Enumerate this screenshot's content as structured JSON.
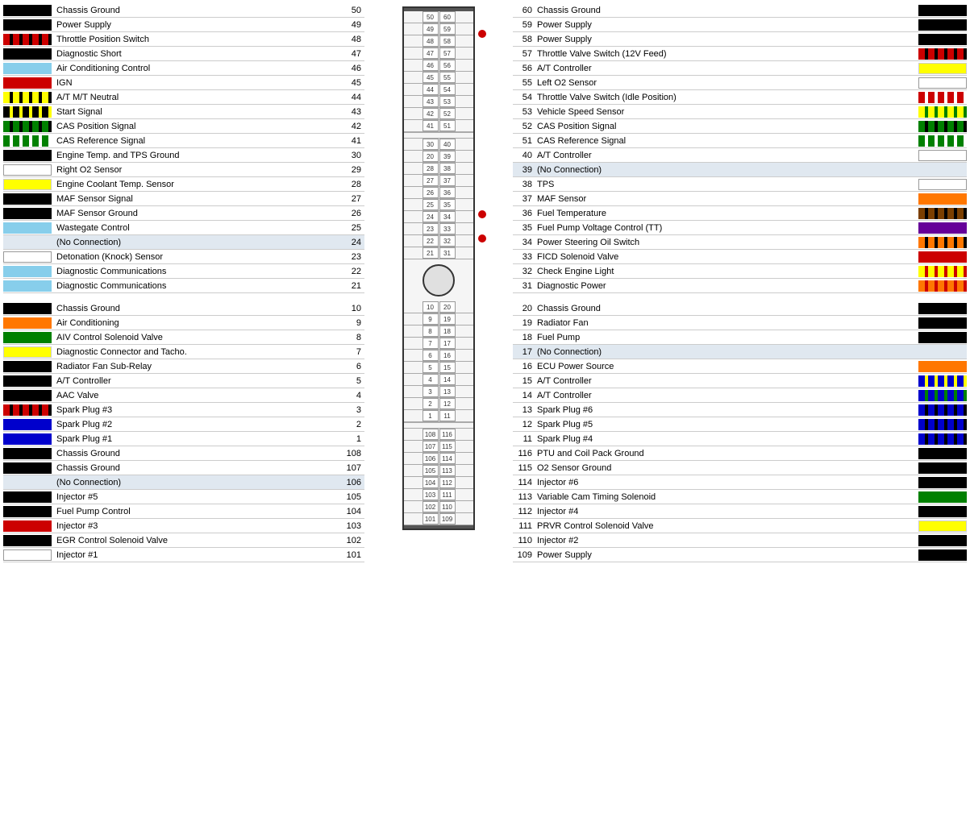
{
  "left_pins": [
    {
      "num": "50",
      "label": "Chassis Ground",
      "wire": "w-black"
    },
    {
      "num": "49",
      "label": "Power Supply",
      "wire": "w-black"
    },
    {
      "num": "48",
      "label": "Throttle Position Switch",
      "wire": "w-red-black"
    },
    {
      "num": "47",
      "label": "Diagnostic Short",
      "wire": "w-black"
    },
    {
      "num": "46",
      "label": "Air Conditioning Control",
      "wire": "w-lightblue"
    },
    {
      "num": "45",
      "label": "IGN",
      "wire": "w-red"
    },
    {
      "num": "44",
      "label": "A/T M/T Neutral",
      "wire": "w-yellow-black"
    },
    {
      "num": "43",
      "label": "Start Signal",
      "wire": "w-black-yellow"
    },
    {
      "num": "42",
      "label": "CAS Position Signal",
      "wire": "w-green-black"
    },
    {
      "num": "41",
      "label": "CAS Reference Signal",
      "wire": "w-green-white"
    },
    {
      "num": "30",
      "label": "Engine Temp. and TPS Ground",
      "wire": "w-black"
    },
    {
      "num": "29",
      "label": "Right O2 Sensor",
      "wire": "w-white"
    },
    {
      "num": "28",
      "label": "Engine Coolant Temp. Sensor",
      "wire": "w-yellow"
    },
    {
      "num": "27",
      "label": "MAF Sensor Signal",
      "wire": "w-black"
    },
    {
      "num": "26",
      "label": "MAF Sensor Ground",
      "wire": "w-black"
    },
    {
      "num": "25",
      "label": "Wastegate Control",
      "wire": "w-lightblue"
    },
    {
      "num": "24",
      "label": "(No Connection)",
      "wire": "w-none",
      "noconn": true
    },
    {
      "num": "23",
      "label": "Detonation (Knock) Sensor",
      "wire": "w-white"
    },
    {
      "num": "22",
      "label": "Diagnostic Communications",
      "wire": "w-lightblue"
    },
    {
      "num": "21",
      "label": "Diagnostic Communications",
      "wire": "w-lightblue"
    },
    {
      "num": "",
      "label": "",
      "wire": "w-none",
      "spacer": true
    },
    {
      "num": "10",
      "label": "Chassis Ground",
      "wire": "w-black"
    },
    {
      "num": "9",
      "label": "Air Conditioning",
      "wire": "w-orange"
    },
    {
      "num": "8",
      "label": "AIV Control Solenoid Valve",
      "wire": "w-green"
    },
    {
      "num": "7",
      "label": "Diagnostic Connector and Tacho.",
      "wire": "w-yellow"
    },
    {
      "num": "6",
      "label": "Radiator Fan Sub-Relay",
      "wire": "w-black"
    },
    {
      "num": "5",
      "label": "A/T Controller",
      "wire": "w-black"
    },
    {
      "num": "4",
      "label": "AAC Valve",
      "wire": "w-black"
    },
    {
      "num": "3",
      "label": "Spark Plug #3",
      "wire": "w-red-black"
    },
    {
      "num": "2",
      "label": "Spark Plug #2",
      "wire": "w-blue"
    },
    {
      "num": "1",
      "label": "Spark Plug #1",
      "wire": "w-blue"
    },
    {
      "num": "108",
      "label": "Chassis Ground",
      "wire": "w-black"
    },
    {
      "num": "107",
      "label": "Chassis Ground",
      "wire": "w-black"
    },
    {
      "num": "106",
      "label": "(No Connection)",
      "wire": "w-none",
      "noconn": true
    },
    {
      "num": "105",
      "label": "Injector #5",
      "wire": "w-black"
    },
    {
      "num": "104",
      "label": "Fuel Pump Control",
      "wire": "w-black"
    },
    {
      "num": "103",
      "label": "Injector #3",
      "wire": "w-red"
    },
    {
      "num": "102",
      "label": "EGR Control Solenoid Valve",
      "wire": "w-black"
    },
    {
      "num": "101",
      "label": "Injector #1",
      "wire": "w-white"
    }
  ],
  "right_pins": [
    {
      "num": "60",
      "label": "Chassis Ground",
      "wire": "w-black"
    },
    {
      "num": "59",
      "label": "Power Supply",
      "wire": "w-black"
    },
    {
      "num": "58",
      "label": "Power Supply",
      "wire": "w-black"
    },
    {
      "num": "57",
      "label": "Throttle Valve Switch (12V Feed)",
      "wire": "w-red-black"
    },
    {
      "num": "56",
      "label": "A/T Controller",
      "wire": "w-yellow"
    },
    {
      "num": "55",
      "label": "Left O2 Sensor",
      "wire": "w-white"
    },
    {
      "num": "54",
      "label": "Throttle Valve Switch (Idle Position)",
      "wire": "w-red-white"
    },
    {
      "num": "53",
      "label": "Vehicle Speed Sensor",
      "wire": "w-yellow-green"
    },
    {
      "num": "52",
      "label": "CAS Position Signal",
      "wire": "w-green-black"
    },
    {
      "num": "51",
      "label": "CAS Reference Signal",
      "wire": "w-green-white"
    },
    {
      "num": "40",
      "label": "A/T Controller",
      "wire": "w-white"
    },
    {
      "num": "39",
      "label": "(No Connection)",
      "wire": "w-none",
      "noconn": true
    },
    {
      "num": "38",
      "label": "TPS",
      "wire": "w-white"
    },
    {
      "num": "37",
      "label": "MAF Sensor",
      "wire": "w-orange"
    },
    {
      "num": "36",
      "label": "Fuel Temperature",
      "wire": "w-brown-black"
    },
    {
      "num": "35",
      "label": "Fuel Pump Voltage Control (TT)",
      "wire": "w-purple"
    },
    {
      "num": "34",
      "label": "Power Steering Oil Switch",
      "wire": "w-orange-black"
    },
    {
      "num": "33",
      "label": "FICD Solenoid Valve",
      "wire": "w-red"
    },
    {
      "num": "32",
      "label": "Check Engine Light",
      "wire": "w-yellow-red"
    },
    {
      "num": "31",
      "label": "Diagnostic Power",
      "wire": "w-orange-red"
    },
    {
      "num": "",
      "label": "",
      "wire": "w-none",
      "spacer": true
    },
    {
      "num": "20",
      "label": "Chassis Ground",
      "wire": "w-black"
    },
    {
      "num": "19",
      "label": "Radiator Fan",
      "wire": "w-black"
    },
    {
      "num": "18",
      "label": "Fuel Pump",
      "wire": "w-black"
    },
    {
      "num": "17",
      "label": "(No Connection)",
      "wire": "w-none",
      "noconn": true
    },
    {
      "num": "16",
      "label": "ECU Power Source",
      "wire": "w-orange"
    },
    {
      "num": "15",
      "label": "A/T Controller",
      "wire": "w-blue-yellow"
    },
    {
      "num": "14",
      "label": "A/T Controller",
      "wire": "w-blue-green"
    },
    {
      "num": "13",
      "label": "Spark Plug #6",
      "wire": "w-blue-black"
    },
    {
      "num": "12",
      "label": "Spark Plug #5",
      "wire": "w-blue-black"
    },
    {
      "num": "11",
      "label": "Spark Plug #4",
      "wire": "w-blue-black"
    },
    {
      "num": "116",
      "label": "PTU and Coil Pack Ground",
      "wire": "w-black"
    },
    {
      "num": "115",
      "label": "O2 Sensor Ground",
      "wire": "w-black"
    },
    {
      "num": "114",
      "label": "Injector #6",
      "wire": "w-black"
    },
    {
      "num": "113",
      "label": "Variable Cam Timing Solenoid",
      "wire": "w-green"
    },
    {
      "num": "112",
      "label": "Injector #4",
      "wire": "w-black"
    },
    {
      "num": "111",
      "label": "PRVR Control Solenoid Valve",
      "wire": "w-yellow"
    },
    {
      "num": "110",
      "label": "Injector #2",
      "wire": "w-black"
    },
    {
      "num": "109",
      "label": "Power Supply",
      "wire": "w-black"
    }
  ],
  "connector": {
    "sections": [
      {
        "rows": [
          [
            "50",
            "60"
          ],
          [
            "49",
            "59"
          ],
          [
            "48",
            "58"
          ],
          [
            "47",
            "57"
          ],
          [
            "46",
            "56"
          ],
          [
            "45",
            "55"
          ],
          [
            "44",
            "54"
          ],
          [
            "43",
            "53"
          ],
          [
            "42",
            "52"
          ],
          [
            "41",
            "51"
          ]
        ]
      },
      {
        "rows": [
          [
            "30",
            "40"
          ],
          [
            "20",
            "39"
          ],
          [
            "28",
            "38"
          ],
          [
            "27",
            "37"
          ],
          [
            "26",
            "36"
          ],
          [
            "25",
            "35"
          ],
          [
            "24",
            "34"
          ],
          [
            "23",
            "33"
          ],
          [
            "22",
            "32"
          ],
          [
            "21",
            "31"
          ]
        ]
      },
      {
        "rows": [
          [
            "10",
            "20"
          ],
          [
            "9",
            "19"
          ],
          [
            "8",
            "18"
          ],
          [
            "7",
            "17"
          ],
          [
            "6",
            "16"
          ],
          [
            "5",
            "15"
          ],
          [
            "4",
            "14"
          ],
          [
            "3",
            "13"
          ],
          [
            "2",
            "12"
          ],
          [
            "1",
            "11"
          ]
        ]
      },
      {
        "rows": [
          [
            "108",
            "116"
          ],
          [
            "107",
            "115"
          ],
          [
            "106",
            "114"
          ],
          [
            "105",
            "113"
          ],
          [
            "104",
            "112"
          ],
          [
            "103",
            "111"
          ],
          [
            "102",
            "110"
          ],
          [
            "101",
            "109"
          ]
        ]
      }
    ]
  },
  "dots": [
    {
      "label": "MAF Signal dot"
    },
    {
      "label": "MAF Ground dot"
    }
  ]
}
